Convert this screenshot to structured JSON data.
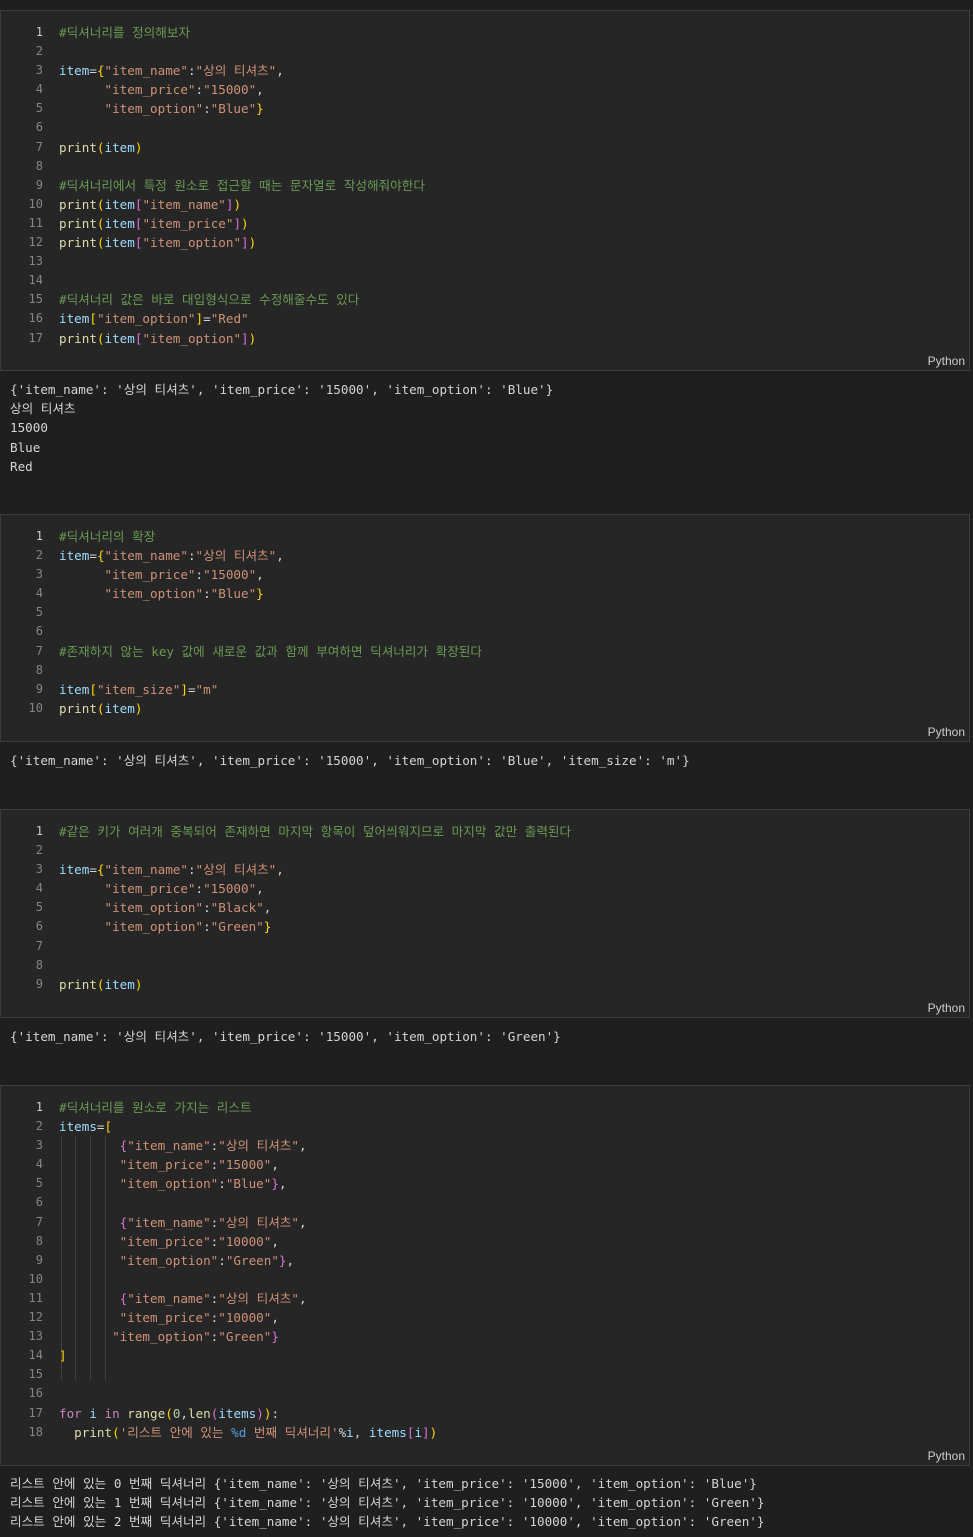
{
  "cells": [
    {
      "language": "Python",
      "lines": [
        [
          "#딕셔너리를 정의해보자"
        ],
        [
          ""
        ],
        [
          "item={\"item_name\":\"상의 티셔츠\","
        ],
        [
          "      \"item_price\":\"15000\","
        ],
        [
          "      \"item_option\":\"Blue\"}"
        ],
        [
          ""
        ],
        [
          "print(item)"
        ],
        [
          ""
        ],
        [
          "#딕셔너리에서 특정 원소로 접근할 때는 문자열로 작성해줘야한다"
        ],
        [
          "print(item[\"item_name\"])"
        ],
        [
          "print(item[\"item_price\"])"
        ],
        [
          "print(item[\"item_option\"])"
        ],
        [
          ""
        ],
        [
          ""
        ],
        [
          "#딕셔너리 값은 바로 대입형식으로 수정해줄수도 있다"
        ],
        [
          "item[\"item_option\"]=\"Red\""
        ],
        [
          "print(item[\"item_option\"])"
        ]
      ],
      "output": [
        "{'item_name': '상의 티셔츠', 'item_price': '15000', 'item_option': 'Blue'}",
        "상의 티셔츠",
        "15000",
        "Blue",
        "Red"
      ]
    },
    {
      "language": "Python",
      "lines": [
        [
          "#딕셔너리의 확장"
        ],
        [
          "item={\"item_name\":\"상의 티셔츠\","
        ],
        [
          "      \"item_price\":\"15000\","
        ],
        [
          "      \"item_option\":\"Blue\"}"
        ],
        [
          ""
        ],
        [
          ""
        ],
        [
          "#존재하지 않는 key 값에 새로운 값과 함께 부여하면 딕셔너리가 확장된다"
        ],
        [
          ""
        ],
        [
          "item[\"item_size\"]=\"m\""
        ],
        [
          "print(item)"
        ]
      ],
      "output": [
        "{'item_name': '상의 티셔츠', 'item_price': '15000', 'item_option': 'Blue', 'item_size': 'm'}"
      ]
    },
    {
      "language": "Python",
      "lines": [
        [
          "#같은 키가 여러개 중복되어 존재하면 마지막 항목이 덮어씌워지므로 마지막 값만 출력된다"
        ],
        [
          ""
        ],
        [
          "item={\"item_name\":\"상의 티셔츠\","
        ],
        [
          "      \"item_price\":\"15000\","
        ],
        [
          "      \"item_option\":\"Black\","
        ],
        [
          "      \"item_option\":\"Green\"}"
        ],
        [
          ""
        ],
        [
          ""
        ],
        [
          "print(item)"
        ]
      ],
      "output": [
        "{'item_name': '상의 티셔츠', 'item_price': '15000', 'item_option': 'Green'}"
      ]
    },
    {
      "language": "Python",
      "lines": [
        [
          "#딕셔너리를 원소로 가지는 리스트"
        ],
        [
          "items=["
        ],
        [
          "        {\"item_name\":\"상의 티셔츠\","
        ],
        [
          "        \"item_price\":\"15000\","
        ],
        [
          "        \"item_option\":\"Blue\"},"
        ],
        [
          ""
        ],
        [
          "        {\"item_name\":\"상의 티셔츠\","
        ],
        [
          "        \"item_price\":\"10000\","
        ],
        [
          "        \"item_option\":\"Green\"},"
        ],
        [
          ""
        ],
        [
          "        {\"item_name\":\"상의 티셔츠\","
        ],
        [
          "        \"item_price\":\"10000\","
        ],
        [
          "       \"item_option\":\"Green\"}"
        ],
        [
          "]"
        ],
        [
          ""
        ],
        [
          ""
        ],
        [
          "for i in range(0,len(items)):"
        ],
        [
          "  print('리스트 안에 있는 %d 번째 딕셔너리'%i, items[i])"
        ]
      ],
      "output": [
        "리스트 안에 있는 0 번째 딕셔너리 {'item_name': '상의 티셔츠', 'item_price': '15000', 'item_option': 'Blue'}",
        "리스트 안에 있는 1 번째 딕셔너리 {'item_name': '상의 티셔츠', 'item_price': '10000', 'item_option': 'Green'}",
        "리스트 안에 있는 2 번째 딕셔너리 {'item_name': '상의 티셔츠', 'item_price': '10000', 'item_option': 'Green'}"
      ]
    }
  ],
  "colors": {
    "comment": "#6a9955",
    "variable": "#9cdcfe",
    "string": "#ce9178",
    "function": "#dcdcaa",
    "keyword": "#c586c0",
    "number": "#b5cea8",
    "bracket1": "#ffd700",
    "bracket2": "#da70d6",
    "bracket3": "#179fff"
  }
}
